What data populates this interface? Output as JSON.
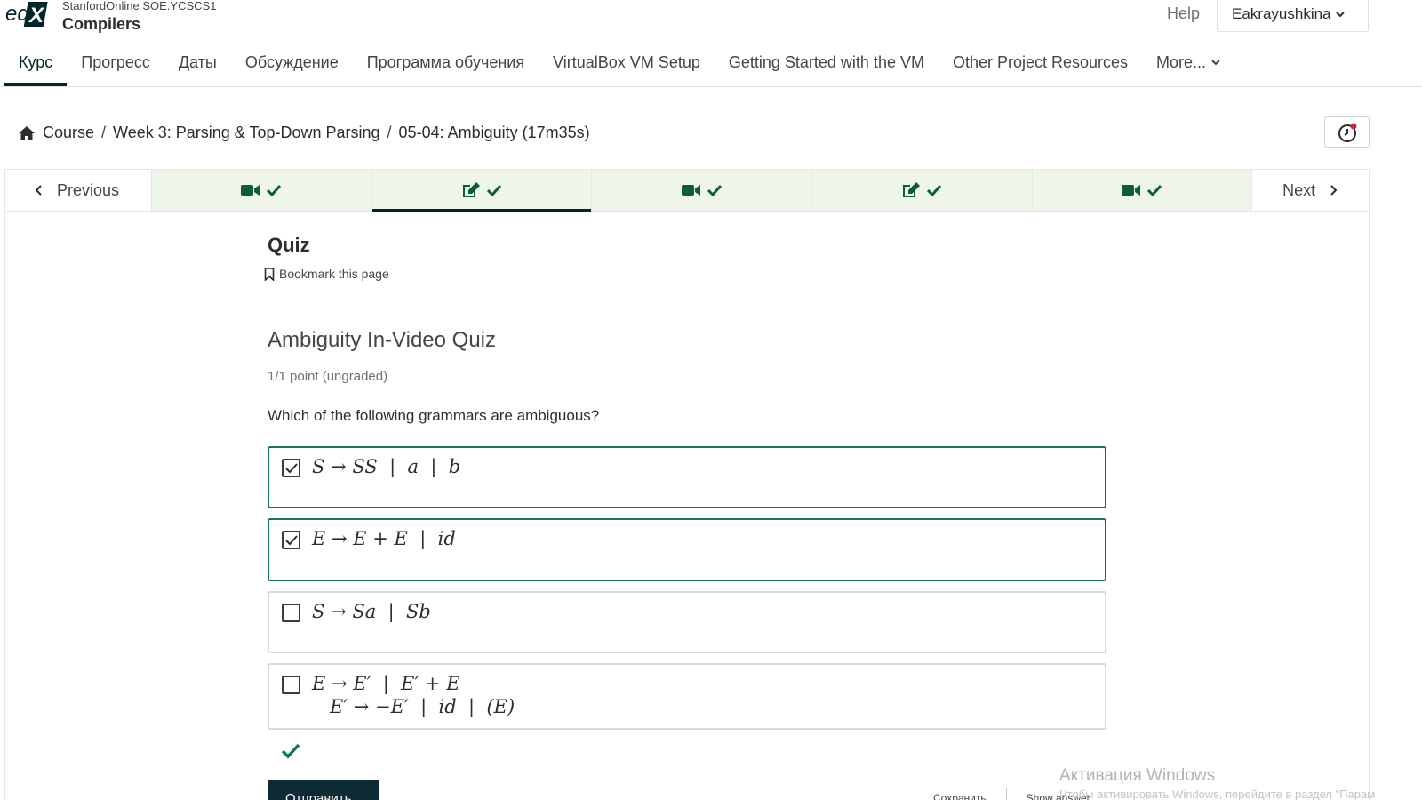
{
  "header": {
    "course_org": "StanfordOnline SOE.YCSCS1",
    "course_name": "Compilers",
    "help_label": "Help",
    "username": "Eakrayushkina"
  },
  "tabs": [
    {
      "label": "Курс",
      "active": true
    },
    {
      "label": "Прогресс"
    },
    {
      "label": "Даты"
    },
    {
      "label": "Обсуждение"
    },
    {
      "label": "Программа обучения"
    },
    {
      "label": "VirtualBox VM Setup"
    },
    {
      "label": "Getting Started with the VM"
    },
    {
      "label": "Other Project Resources"
    },
    {
      "label": "More..."
    }
  ],
  "breadcrumb": {
    "course": "Course",
    "section": "Week 3: Parsing & Top-Down Parsing",
    "unit": "05-04: Ambiguity (17m35s)"
  },
  "sequence": {
    "previous_label": "Previous",
    "next_label": "Next",
    "units": [
      {
        "icon": "video-icon",
        "completed": true
      },
      {
        "icon": "edit-icon",
        "completed": true,
        "active": true
      },
      {
        "icon": "video-icon",
        "completed": true
      },
      {
        "icon": "edit-icon",
        "completed": true
      },
      {
        "icon": "video-icon",
        "completed": true
      }
    ]
  },
  "unit": {
    "title": "Quiz",
    "bookmark_label": "Bookmark this page"
  },
  "problem": {
    "title": "Ambiguity In-Video Quiz",
    "score": "1/1 point (ungraded)",
    "question": "Which of the following grammars are ambiguous?",
    "choices": [
      {
        "line1": "S → SS  |  a  |  b",
        "checked": true
      },
      {
        "line1": "E → E + E  |  id",
        "checked": true
      },
      {
        "line1": "S → Sa  |  Sb",
        "checked": false
      },
      {
        "line1": "E → E′  |  E′ + E",
        "line2": "E′ → −E′  |  id  |  (E)",
        "checked": false
      }
    ],
    "submit_label": "Отправить",
    "save_label": "Сохранить",
    "show_answer_label": "Show answer"
  },
  "overlay": {
    "activate_title": "Активация Windows",
    "activate_sub": "Чтобы активировать Windows, перейдите в раздел \"Парам"
  },
  "colors": {
    "brand_dark": "#00262b",
    "correct_green": "#15784b",
    "sequence_complete_bg": "#eef5ea"
  }
}
